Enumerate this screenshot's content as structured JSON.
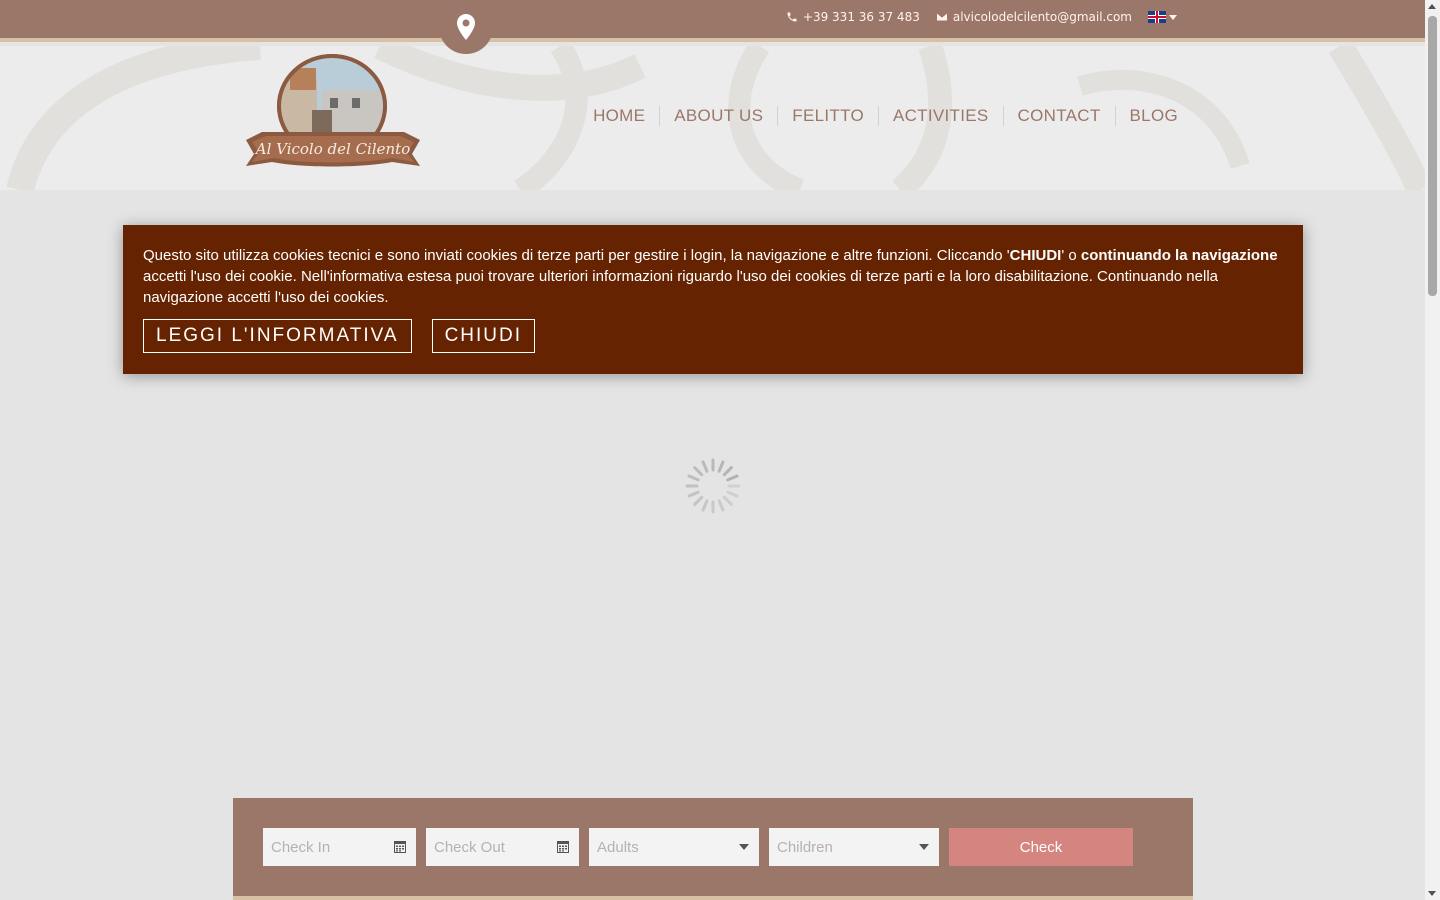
{
  "topbar": {
    "phone": "+39 331 36 37 483",
    "email": "alvicolodelcilento@gmail.com",
    "language_flag": "uk-flag-icon",
    "location_icon": "map-pin-icon"
  },
  "logo": {
    "text": "Al Vicolo del Cilento"
  },
  "nav": {
    "items": [
      "HOME",
      "ABOUT US",
      "FELITTO",
      "ACTIVITIES",
      "CONTACT",
      "BLOG"
    ]
  },
  "cookie": {
    "text_1": "Questo sito utilizza cookies tecnici e sono inviati cookies di terze parti per gestire i login, la navigazione e altre funzioni. Cliccando '",
    "bold_1": "CHIUDI",
    "text_2": "' o ",
    "bold_2": "continuando la navigazione",
    "text_3": " accetti l'uso dei cookie. Nell'informativa estesa puoi trovare ulteriori informazioni riguardo l'uso dei cookies di terze parti e la loro disabilitazione. Continuando nella navigazione accetti l'uso dei cookies.",
    "read_label": "LEGGI L'INFORMATIVA",
    "close_label": "CHIUDI"
  },
  "booking": {
    "checkin_placeholder": "Check In",
    "checkout_placeholder": "Check Out",
    "adults_placeholder": "Adults",
    "children_placeholder": "Children",
    "check_label": "Check"
  },
  "colors": {
    "topbar": "#9b776a",
    "accent_strip": "#d7c0a3",
    "cookie_bg": "#662302",
    "check_button": "#d5857f"
  }
}
